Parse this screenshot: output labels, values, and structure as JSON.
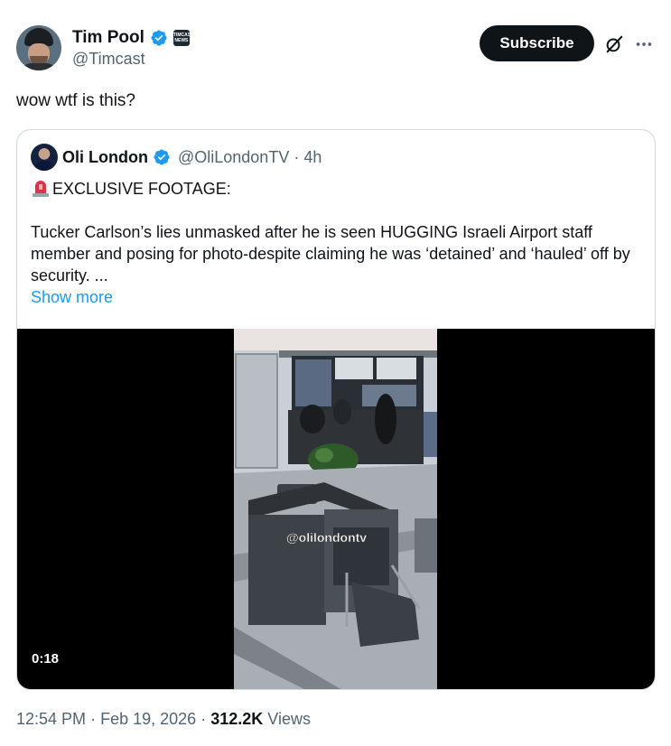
{
  "author": {
    "display_name": "Tim Pool",
    "handle": "@Timcast",
    "affiliate_label": "TIMCAST NEWS"
  },
  "actions": {
    "subscribe_label": "Subscribe"
  },
  "tweet": {
    "text": "wow wtf is this?"
  },
  "quoted": {
    "display_name": "Oli London",
    "handle": "@OliLondonTV",
    "separator": "·",
    "time": "4h",
    "headline": "EXCLUSIVE FOOTAGE:",
    "body": "Tucker Carlson’s lies unmasked after he is seen HUGGING Israeli Airport staff member and posing for photo-despite claiming he was ‘detained’ and ‘hauled’ off by security. ...",
    "show_more": "Show more",
    "video": {
      "watermark": "@olilondontv",
      "duration": "0:18"
    }
  },
  "footer": {
    "time": "12:54 PM",
    "sep1": "·",
    "date": "Feb 19, 2026",
    "sep2": "·",
    "views_count": "312.2K",
    "views_label": "Views"
  },
  "colors": {
    "accent": "#1d9bf0",
    "verified": "#1d9bf0",
    "secondary_text": "#536471",
    "subscribe_bg": "#0f1419"
  },
  "icons": [
    "verified-badge-icon",
    "affiliate-badge-icon",
    "grok-icon",
    "more-options-icon",
    "siren-emoji-icon"
  ]
}
